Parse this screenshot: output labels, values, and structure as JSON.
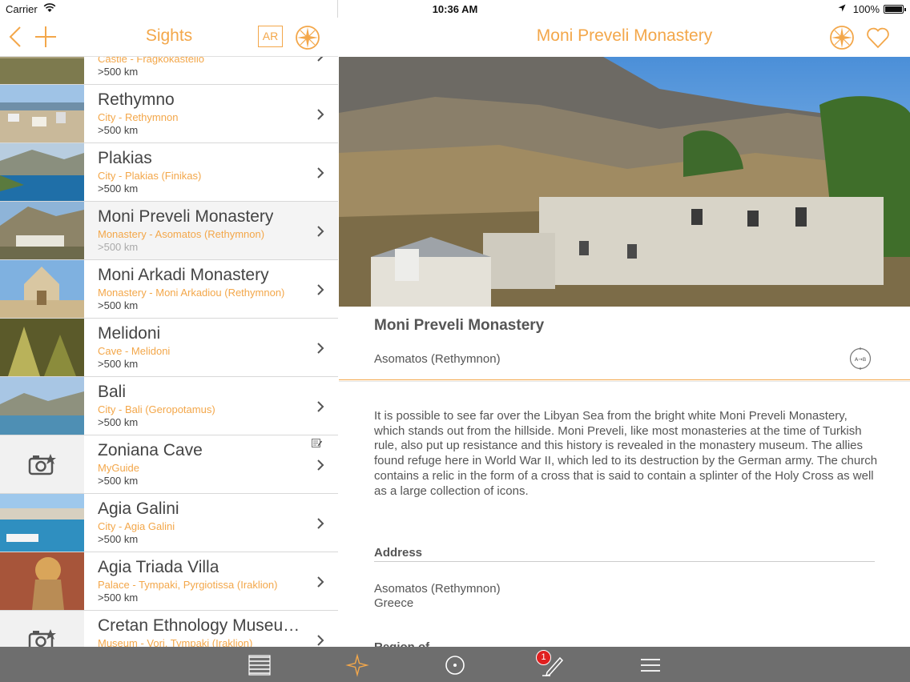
{
  "status_bar": {
    "carrier": "Carrier",
    "time": "10:36 AM",
    "battery": "100%"
  },
  "left_nav": {
    "title": "Sights",
    "ar_label": "AR"
  },
  "list": [
    {
      "name": "",
      "category": "Castle - Fragkokastello",
      "distance": ">500 km"
    },
    {
      "name": "Rethymno",
      "category": "City - Rethymnon",
      "distance": ">500 km"
    },
    {
      "name": "Plakias",
      "category": "City - Plakias (Finikas)",
      "distance": ">500 km"
    },
    {
      "name": "Moni Preveli Monastery",
      "category": "Monastery - Asomatos (Rethymnon)",
      "distance": ">500 km"
    },
    {
      "name": "Moni Arkadi Monastery",
      "category": "Monastery - Moni Arkadiou (Rethymnon)",
      "distance": ">500 km"
    },
    {
      "name": "Melidoni",
      "category": "Cave - Melidoni",
      "distance": ">500 km"
    },
    {
      "name": "Bali",
      "category": "City - Bali (Geropotamus)",
      "distance": ">500 km"
    },
    {
      "name": "Zoniana Cave",
      "category": "MyGuide",
      "distance": ">500 km"
    },
    {
      "name": "Agia Galini",
      "category": "City - Agia Galini",
      "distance": ">500 km"
    },
    {
      "name": "Agia Triada Villa",
      "category": "Palace - Tympaki, Pyrgiotissa (Iraklion)",
      "distance": ">500 km"
    },
    {
      "name": "Cretan Ethnology Museu…",
      "category": "Museum - Vori, Tympaki (Iraklion)",
      "distance": ""
    }
  ],
  "detail": {
    "nav_title": "Moni Preveli Monastery",
    "title": "Moni Preveli Monastery",
    "subtitle": "Asomatos (Rethymnon)",
    "route_label": "A→B",
    "description": "It is possible to see far over the Libyan Sea from the bright white Moni Preveli Monastery, which stands out from the hillside. Moni Preveli, like most monasteries at the time of Turkish rule, also put up resistance and this history is revealed in the monastery museum. The allies found refuge here in World War II, which led to its destruction by the German army. The church contains a relic in the form of a cross that is said to contain a splinter of the Holy Cross as well as a large collection of icons.",
    "address_heading": "Address",
    "address_line1": "Asomatos (Rethymnon)",
    "address_line2": "Greece",
    "next_heading_partial": "Region of ..."
  },
  "tabbar": {
    "badge_count": "1"
  },
  "colors": {
    "accent": "#f3a74a",
    "tabbar": "#6e6e6e",
    "badge": "#e02020"
  }
}
